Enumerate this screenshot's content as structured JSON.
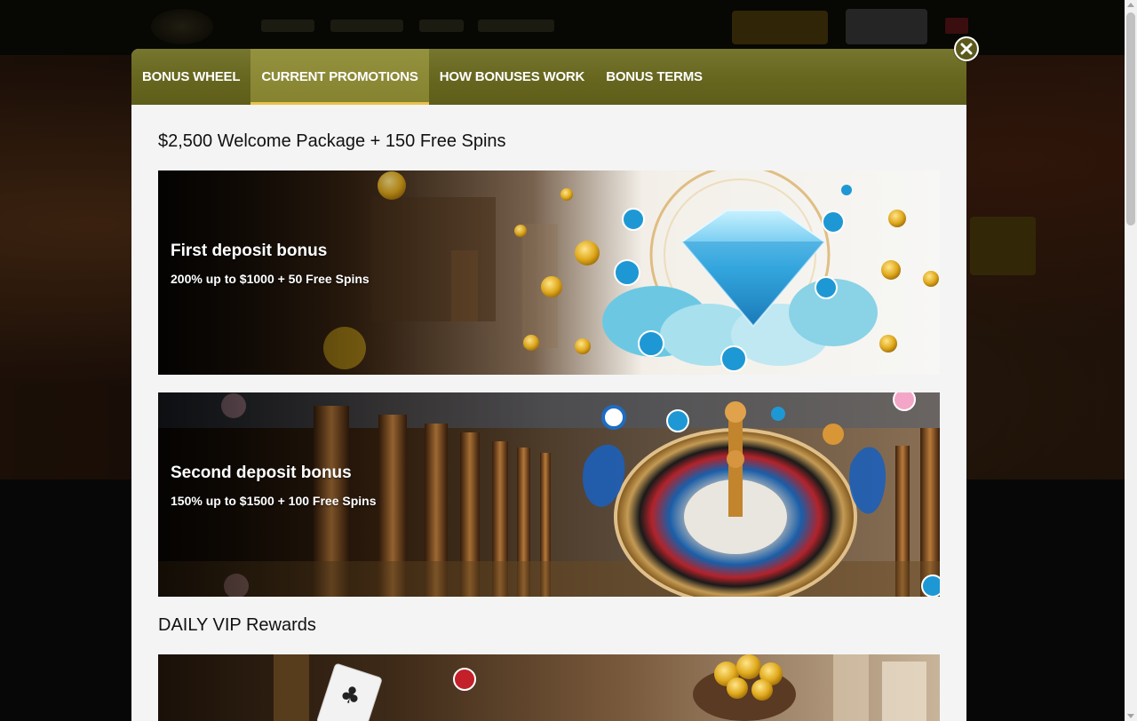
{
  "modal": {
    "tabs": [
      {
        "label": "BONUS WHEEL",
        "active": false
      },
      {
        "label": "CURRENT PROMOTIONS",
        "active": true
      },
      {
        "label": "HOW BONUSES WORK",
        "active": false
      },
      {
        "label": "BONUS TERMS",
        "active": false
      }
    ],
    "close_icon": "close-icon",
    "sections": [
      {
        "title": "$2,500 Welcome Package + 150 Free Spins",
        "banners": [
          {
            "title": "First deposit bonus",
            "subtitle": "200% up to $1000 + 50 Free Spins",
            "art": "diamond-gem-art"
          },
          {
            "title": "Second deposit bonus",
            "subtitle": "150% up to $1500 + 100 Free Spins",
            "art": "roulette-wheel-art"
          }
        ]
      },
      {
        "title": "DAILY VIP Rewards",
        "banners": [
          {
            "title": "",
            "subtitle": "",
            "art": "gold-coins-pot-art"
          }
        ]
      }
    ]
  },
  "colors": {
    "tab_bar": "#66661f",
    "tab_active": "#8a8835",
    "tab_underline": "#e8c24a",
    "modal_body": "#f4f4f4",
    "close_button": "#5b5a1c"
  }
}
